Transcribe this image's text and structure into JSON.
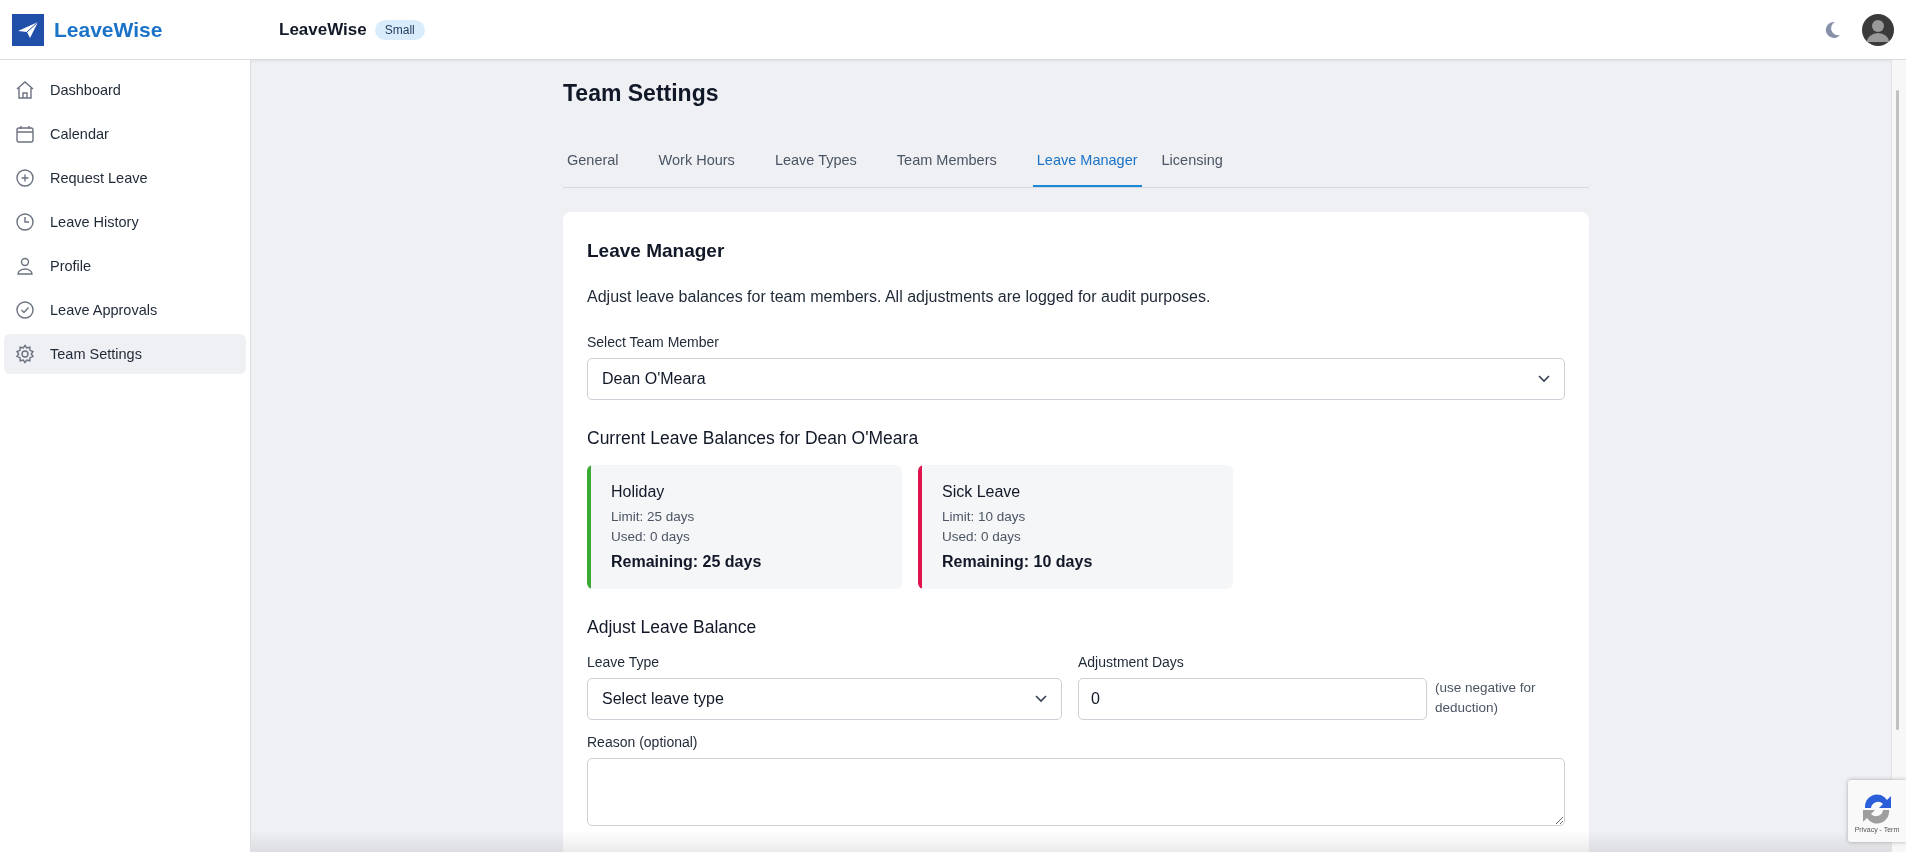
{
  "app": {
    "name": "LeaveWise"
  },
  "header": {
    "title": "LeaveWise",
    "plan_badge": "Small"
  },
  "sidebar": {
    "items": [
      {
        "label": "Dashboard",
        "kind": "home",
        "selected": false
      },
      {
        "label": "Calendar",
        "kind": "calendar",
        "selected": false
      },
      {
        "label": "Request Leave",
        "kind": "plus",
        "selected": false
      },
      {
        "label": "Leave History",
        "kind": "clock",
        "selected": false
      },
      {
        "label": "Profile",
        "kind": "user",
        "selected": false
      },
      {
        "label": "Leave Approvals",
        "kind": "check",
        "selected": false
      },
      {
        "label": "Team Settings",
        "kind": "gear",
        "selected": true
      }
    ]
  },
  "page": {
    "title": "Team Settings"
  },
  "tabs": [
    {
      "label": "General",
      "selected": false
    },
    {
      "label": "Work Hours",
      "selected": false
    },
    {
      "label": "Leave Types",
      "selected": false
    },
    {
      "label": "Team Members",
      "selected": false
    },
    {
      "label": "Leave Manager",
      "selected": true
    },
    {
      "label": "Licensing",
      "selected": false
    }
  ],
  "panel": {
    "title": "Leave Manager",
    "description": "Adjust leave balances for team members. All adjustments are logged for audit purposes.",
    "member_label": "Select Team Member",
    "member_value": "Dean O'Meara",
    "balances_title": "Current Leave Balances for Dean O'Meara",
    "balances": [
      {
        "name": "Holiday",
        "limit": "Limit: 25 days",
        "used": "Used: 0 days",
        "remaining": "Remaining: 25 days",
        "color": "#3aaa35"
      },
      {
        "name": "Sick Leave",
        "limit": "Limit: 10 days",
        "used": "Used: 0 days",
        "remaining": "Remaining: 10 days",
        "color": "#e0144c"
      }
    ],
    "adjust_title": "Adjust Leave Balance",
    "leave_type_label": "Leave Type",
    "leave_type_value": "Select leave type",
    "days_label": "Adjustment Days",
    "days_value": "0",
    "days_hint": "(use negative for deduction)",
    "reason_label": "Reason (optional)"
  },
  "recaptcha": {
    "text": "Privacy - Term"
  }
}
